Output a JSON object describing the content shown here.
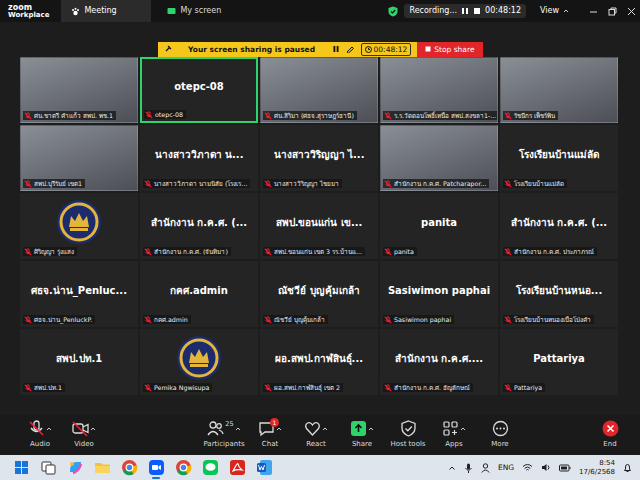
{
  "app": {
    "brand": "zoom",
    "product": "Workplace"
  },
  "tabs": [
    {
      "label": "Meeting",
      "selected": true
    },
    {
      "label": "My screen",
      "selected": false
    }
  ],
  "recording": {
    "label": "Recording...",
    "time": "00:48:12",
    "view": "View"
  },
  "banner": {
    "text": "Your screen sharing is paused",
    "time": "00:48:12",
    "stop": "Stop share"
  },
  "tiles": [
    {
      "kind": "video",
      "label": "ศน.ชาตรี คำแก้ว สพป. พช.1",
      "muted": true,
      "active": false
    },
    {
      "kind": "name",
      "name": "otepc-08",
      "label": "otepc-08",
      "muted": true,
      "active": true
    },
    {
      "kind": "video",
      "label": "ศน.สิริมา (ศธจ.สุราษฎร์ธานี)",
      "muted": true,
      "active": false
    },
    {
      "kind": "video",
      "label": "ร.ร.วัดดอนโพธิ์เหนือ สพป.สงขลา1-...",
      "muted": true,
      "active": false
    },
    {
      "kind": "video",
      "label": "รัชนีกร เพ็ชร์พิน",
      "muted": true,
      "active": false
    },
    {
      "kind": "video",
      "label": "สพป.บุรีรัมย์ เขต1",
      "muted": true,
      "active": false
    },
    {
      "kind": "name",
      "name": "นางสาววิภาดา น...",
      "label": "นางสาววิภาดา นามนิสัย (โรงเร...",
      "muted": true,
      "active": false
    },
    {
      "kind": "name",
      "name": "นางสาววิริญญา ไ...",
      "label": "นางสาววิริญญา ไชยมา",
      "muted": true,
      "active": false
    },
    {
      "kind": "video",
      "label": "สำนักงาน ก.ค.ศ. Patcharapor...",
      "muted": true,
      "active": false
    },
    {
      "kind": "name",
      "name": "โรงเรียนบ้านแม่ลัด",
      "label": "โรงเรียนบ้านแม่ลัด",
      "muted": true,
      "active": false
    },
    {
      "kind": "avatar",
      "label": "ศิริญญา รุ่งแสง",
      "muted": true,
      "active": false
    },
    {
      "kind": "name",
      "name": "สำนักงาน ก.ค.ศ. (...",
      "label": "สำนักงาน ก.ค.ศ. (จันทิมา)",
      "muted": true,
      "active": false
    },
    {
      "kind": "name",
      "name": "สพป.ขอนแก่น เข...",
      "label": "สพป.ขอนแก่น เขต 3 รร.บ้านแ...",
      "muted": true,
      "active": false
    },
    {
      "kind": "name",
      "name": "panita",
      "label": "panita",
      "muted": true,
      "active": false
    },
    {
      "kind": "name",
      "name": "สำนักงาน ก.ค.ศ. (...",
      "label": "สำนักงาน ก.ค.ศ. ประภาภรณ์",
      "muted": true,
      "active": false
    },
    {
      "kind": "name",
      "name": "ศธจ.น่าน_Penluc...",
      "label": "ศธจ.น่าน_PenluckP.",
      "muted": true,
      "active": false
    },
    {
      "kind": "name",
      "name": "กคศ.admin",
      "label": "กคศ.admin",
      "muted": true,
      "active": false
    },
    {
      "kind": "name",
      "name": "ณัชวีย์ บุญคุ้มเกล้า",
      "label": "ณัชวีย์ บุญคุ้มเกล้า",
      "muted": true,
      "active": false
    },
    {
      "kind": "name",
      "name": "Sasiwimon paphai",
      "label": "Sasiwimon paphai",
      "muted": true,
      "active": false
    },
    {
      "kind": "name",
      "name": "โรงเรียนบ้านหนอ...",
      "label": "โรงเรียนบ้านหนองเบือโป่งคำ",
      "muted": true,
      "active": false
    },
    {
      "kind": "name",
      "name": "สพป.ปท.1",
      "label": "สพป.ปท.1",
      "muted": true,
      "active": false
    },
    {
      "kind": "avatar",
      "label": "Pemika Ngwisupa",
      "muted": true,
      "active": false
    },
    {
      "kind": "name",
      "name": "ผอ.สพป.กาฬสินธุ์...",
      "label": "ผอ.สพป.กาฬสินธุ์ เขต 2",
      "muted": true,
      "active": false
    },
    {
      "kind": "name",
      "name": "สำนักงาน ก.ค.ศ....",
      "label": "สำนักงาน ก.ค.ศ. ธัญลักษณ์",
      "muted": true,
      "active": false
    },
    {
      "kind": "name",
      "name": "Pattariya",
      "label": "Pattariya",
      "muted": true,
      "active": false
    }
  ],
  "toolbar": [
    {
      "label": "Audio",
      "kind": "audio",
      "off": true
    },
    {
      "label": "Video",
      "kind": "video",
      "off": true
    },
    {
      "label": "Participants",
      "kind": "participants",
      "off": false,
      "count": "25"
    },
    {
      "label": "Chat",
      "kind": "chat",
      "off": false,
      "badge": "1"
    },
    {
      "label": "React",
      "kind": "react",
      "off": false
    },
    {
      "label": "Share",
      "kind": "share",
      "off": false
    },
    {
      "label": "Host tools",
      "kind": "host",
      "off": false
    },
    {
      "label": "Apps",
      "kind": "apps",
      "off": false
    },
    {
      "label": "More",
      "kind": "more",
      "off": false
    },
    {
      "label": "End",
      "kind": "end",
      "off": false
    }
  ],
  "taskbar": {
    "apps": [
      {
        "kind": "start",
        "selected": false
      },
      {
        "kind": "taskview",
        "selected": false
      },
      {
        "kind": "copilot",
        "selected": false
      },
      {
        "kind": "explorer",
        "selected": false
      },
      {
        "kind": "chrome",
        "selected": false
      },
      {
        "kind": "zoom",
        "selected": true
      },
      {
        "kind": "chrome",
        "selected": false
      },
      {
        "kind": "line",
        "selected": false
      },
      {
        "kind": "acrobat",
        "selected": false
      },
      {
        "kind": "word",
        "selected": false
      }
    ],
    "lang": "ENG",
    "time": "8:54",
    "date": "17/6/2568"
  }
}
